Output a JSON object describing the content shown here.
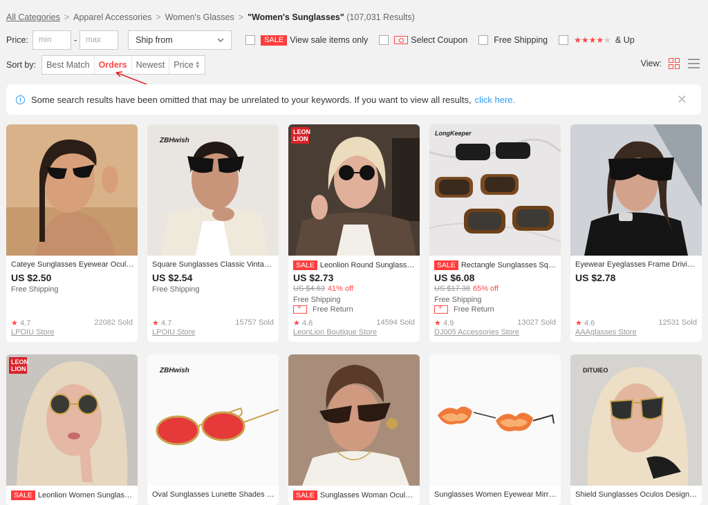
{
  "breadcrumb": {
    "items": [
      "All Categories",
      "Apparel Accessories",
      "Women's Glasses"
    ],
    "query": "\"Women's Sunglasses\"",
    "count": "(107,031 Results)",
    "separator": ">"
  },
  "filters": {
    "price_label": "Price:",
    "min_placeholder": "min",
    "max_placeholder": "max",
    "dash": "-",
    "ship_from": "Ship from",
    "sale_badge": "SALE",
    "sale_label": "View sale items only",
    "coupon_label": "Select Coupon",
    "free_shipping_label": "Free Shipping",
    "rating_label": "& Up",
    "rating_stars": 4
  },
  "sort": {
    "label": "Sort by:",
    "options": [
      "Best Match",
      "Orders",
      "Newest",
      "Price"
    ],
    "active": "Orders"
  },
  "view": {
    "label": "View:",
    "mode": "grid"
  },
  "notice": {
    "text": "Some search results have been omitted that may be unrelated to your keywords. If you want to view all results,",
    "link": "click here."
  },
  "colors": {
    "accent": "#ff4747",
    "link": "#2e9cf0",
    "background": "#f2f2f2"
  },
  "products": [
    {
      "title": "Cateye Sunglasses Eyewear Oculos Women Vintage",
      "price": "US $2.50",
      "shipping": "Free Shipping",
      "rating": "4.7",
      "sold": "22082 Sold",
      "store": "LPOIU Store",
      "sale": false
    },
    {
      "title": "Square Sunglasses Classic Vintage Women Brand",
      "price": "US $2.54",
      "shipping": "Free Shipping",
      "rating": "4.7",
      "sold": "15757 Sold",
      "store": "LPOIU Store",
      "brand_text": "ZBHwish",
      "sale": false
    },
    {
      "title": "Leonlion Round Sunglasses Women",
      "price": "US $2.73",
      "original": "US $4.63",
      "discount": "41% off",
      "shipping": "Free Shipping",
      "return": "Free Return",
      "rating": "4.6",
      "sold": "14594 Sold",
      "store": "LeonLion Boutique Store",
      "brand_mark": "LEON LION",
      "sale": true
    },
    {
      "title": "Rectangle Sunglasses Square Women",
      "price": "US $6.08",
      "original": "US $17.38",
      "discount": "65% off",
      "shipping": "Free Shipping",
      "return": "Free Return",
      "rating": "4.9",
      "sold": "13027 Sold",
      "store": "DJ005 Accessories Store",
      "brand_text": "LongKeeper",
      "sale": true
    },
    {
      "title": "Eyewear Eyeglasses Frame Driving Women",
      "price": "US $2.78",
      "shipping": "",
      "rating": "4.6",
      "sold": "12531 Sold",
      "store": "AAAglasses Store",
      "sale": false
    },
    {
      "title": "Leonlion Women Sunglasses Round",
      "price": "",
      "sale": true,
      "brand_mark": "LEON LION"
    },
    {
      "title": "Oval Sunglasses Lunette Shades Black Women",
      "price": "",
      "sale": false,
      "brand_text": "ZBHwish"
    },
    {
      "title": "Sunglasses Woman Oculos Cat Eye",
      "price": "",
      "sale": true
    },
    {
      "title": "Sunglasses Women Eyewear Mirror Fire",
      "price": "",
      "sale": false
    },
    {
      "title": "Shield Sunglasses Oculos Designer Women",
      "price": "",
      "sale": false,
      "brand_text": "DITUIEO"
    }
  ]
}
